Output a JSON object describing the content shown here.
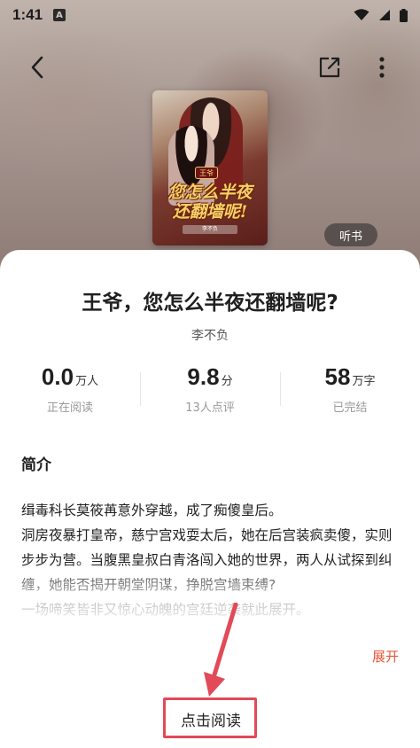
{
  "status_bar": {
    "time": "1:41",
    "notification_glyph": "A",
    "icons": [
      "wifi-icon",
      "signal-icon",
      "battery-icon"
    ]
  },
  "header": {
    "icons": [
      "back-icon",
      "share-icon",
      "more-icon"
    ],
    "audiobook_label": "听书"
  },
  "cover": {
    "badge": "王爷",
    "title_line1": "您怎么半夜",
    "title_line2": "还翻墙呢!",
    "author_tag": "李不负"
  },
  "book": {
    "title": "王爷，您怎么半夜还翻墙呢?",
    "author": "李不负"
  },
  "stats": [
    {
      "value": "0.0",
      "unit": "万人",
      "label": "正在阅读"
    },
    {
      "value": "9.8",
      "unit": "分",
      "label": "13人点评"
    },
    {
      "value": "58",
      "unit": "万字",
      "label": "已完结"
    }
  ],
  "intro": {
    "heading": "简介",
    "paragraphs": [
      "缉毒科长莫筱苒意外穿越，成了痴傻皇后。",
      "洞房夜暴打皇帝，慈宁宫戏耍太后，她在后宫装疯卖傻，实则步步为营。当腹黑皇叔白青洛闯入她的世界，两人从试探到纠缠，她能否揭开朝堂阴谋，挣脱宫墙束缚?",
      "一场啼笑皆非又惊心动魄的宫廷逆袭就此展开。"
    ],
    "expand_label": "展开"
  },
  "actions": {
    "read_label": "点击阅读"
  },
  "colors": {
    "accent": "#e8563b",
    "annotation": "#e24a57"
  }
}
